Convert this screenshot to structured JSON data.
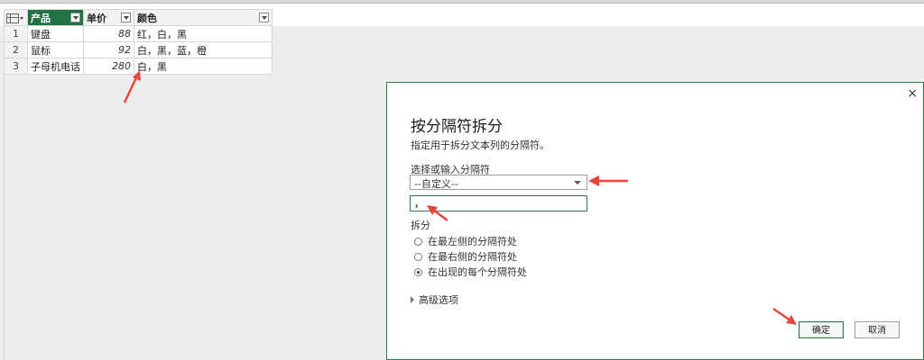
{
  "table": {
    "columns": [
      {
        "name": "产品"
      },
      {
        "name": "单价"
      },
      {
        "name": "颜色"
      }
    ],
    "rows": [
      {
        "num": "1",
        "product": "键盘",
        "price": "88",
        "color": "红，白，黑"
      },
      {
        "num": "2",
        "product": "鼠标",
        "price": "92",
        "color": "白，黑，蓝，橙"
      },
      {
        "num": "3",
        "product": "子母机电话",
        "price": "280",
        "color": "白，黑"
      }
    ]
  },
  "dialog": {
    "title": "按分隔符拆分",
    "description": "指定用于拆分文本列的分隔符。",
    "select_label": "选择或输入分隔符",
    "select_value": "--自定义--",
    "input_value": "，",
    "split_label": "拆分",
    "options": [
      {
        "label": "在最左侧的分隔符处",
        "checked": false
      },
      {
        "label": "在最右侧的分隔符处",
        "checked": false
      },
      {
        "label": "在出现的每个分隔符处",
        "checked": true
      }
    ],
    "advanced_label": "高级选项",
    "ok_label": "确定",
    "cancel_label": "取消",
    "close_glyph": "×"
  },
  "colors": {
    "accent": "#217346",
    "dialog_border": "#2e7d4f",
    "annotation": "#e8453c"
  }
}
